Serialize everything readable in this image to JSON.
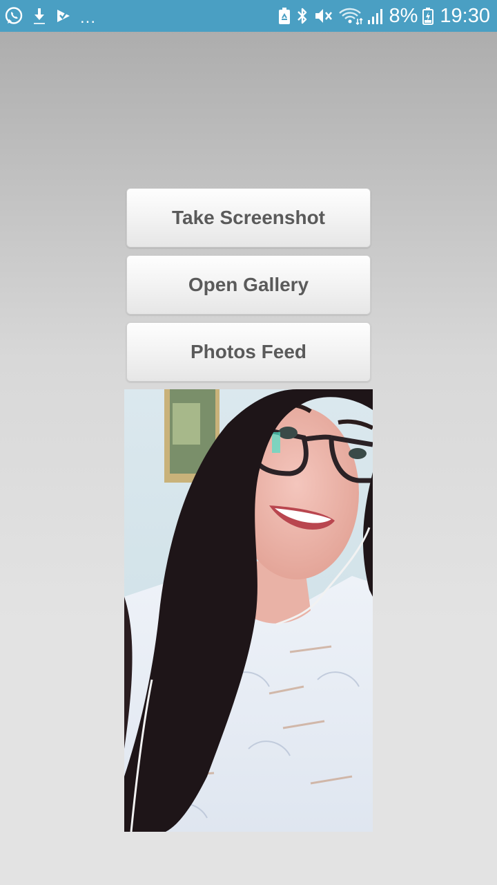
{
  "status_bar": {
    "left_icons": [
      "whatsapp-icon",
      "download-icon",
      "check-flag-icon"
    ],
    "overflow": "...",
    "right_icons": [
      "battery-saver-icon",
      "bluetooth-icon",
      "mute-icon",
      "wifi-icon",
      "signal-icon",
      "battery-icon"
    ],
    "battery_percent": "8%",
    "time": "19:30"
  },
  "buttons": {
    "take_screenshot": "Take Screenshot",
    "open_gallery": "Open Gallery",
    "photos_feed": "Photos Feed"
  },
  "photo": {
    "description_icon": "selfie-photo"
  },
  "colors": {
    "status_bar": "#4a9fc3",
    "button_text": "#5a5a5a",
    "background_top": "#a9a9a9",
    "background_bottom": "#e3e3e3"
  }
}
